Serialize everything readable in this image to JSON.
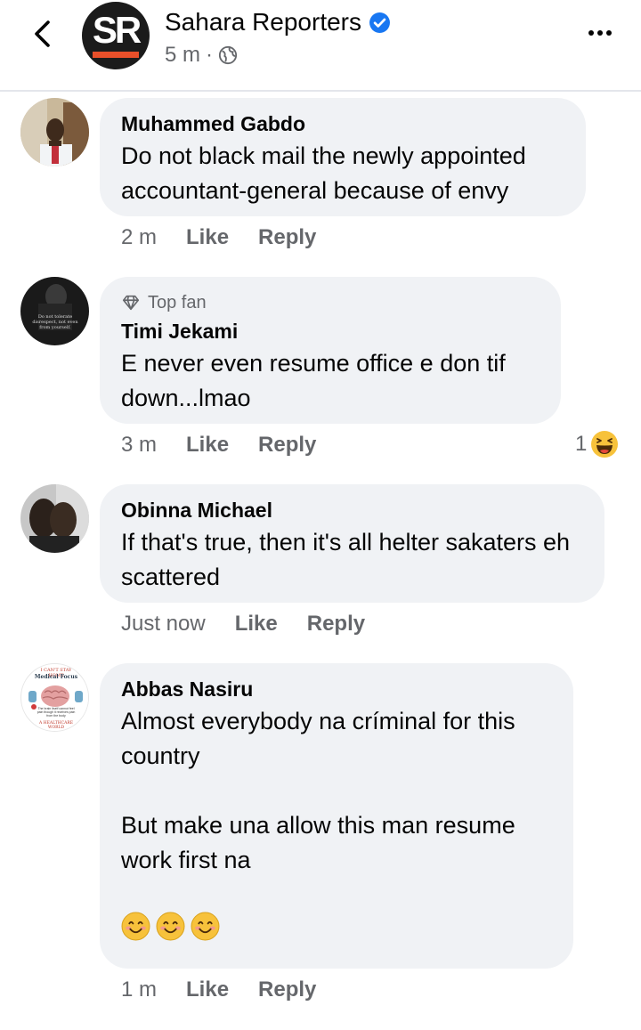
{
  "header": {
    "page_name": "Sahara Reporters",
    "avatar_text": "SR",
    "time": "5 m",
    "separator": "·",
    "icons": [
      "back-icon",
      "verified-icon",
      "globe-icon",
      "more-icon"
    ]
  },
  "comments": [
    {
      "author": "Muhammed Gabdo",
      "text": "Do not black mail the newly appointed accountant-general because of envy",
      "time": "2 m",
      "like": "Like",
      "reply": "Reply"
    },
    {
      "badge": "Top fan",
      "author": "Timi Jekami",
      "text": "E never even resume office e don tif down...lmao",
      "time": "3 m",
      "like": "Like",
      "reply": "Reply",
      "reaction_count": "1",
      "avatar_text": "Do not tolerate disrespect, not even from yourself."
    },
    {
      "author": "Obinna Michael",
      "text": "If that's true, then it's all helter sakaters eh scattered",
      "time": "Just now",
      "like": "Like",
      "reply": "Reply"
    },
    {
      "author": "Abbas Nasiru",
      "text": "Almost everybody na críminal for this country\n\nBut make una allow this man resume work first na",
      "time": "1 m",
      "like": "Like",
      "reply": "Reply",
      "avatar_text_top": "I CAN'T STAY HOME",
      "avatar_text_mid": "Medical Focus",
      "avatar_text_body": "The brain itself cannot feel pain though it receives pain from the body",
      "avatar_text_bottom": "A HEALTHCARE WORLD"
    }
  ],
  "colors": {
    "bubble": "#f0f2f5",
    "secondary_text": "#65676b",
    "verified_blue": "#1877f2",
    "logo_bar": "#e8502a"
  }
}
